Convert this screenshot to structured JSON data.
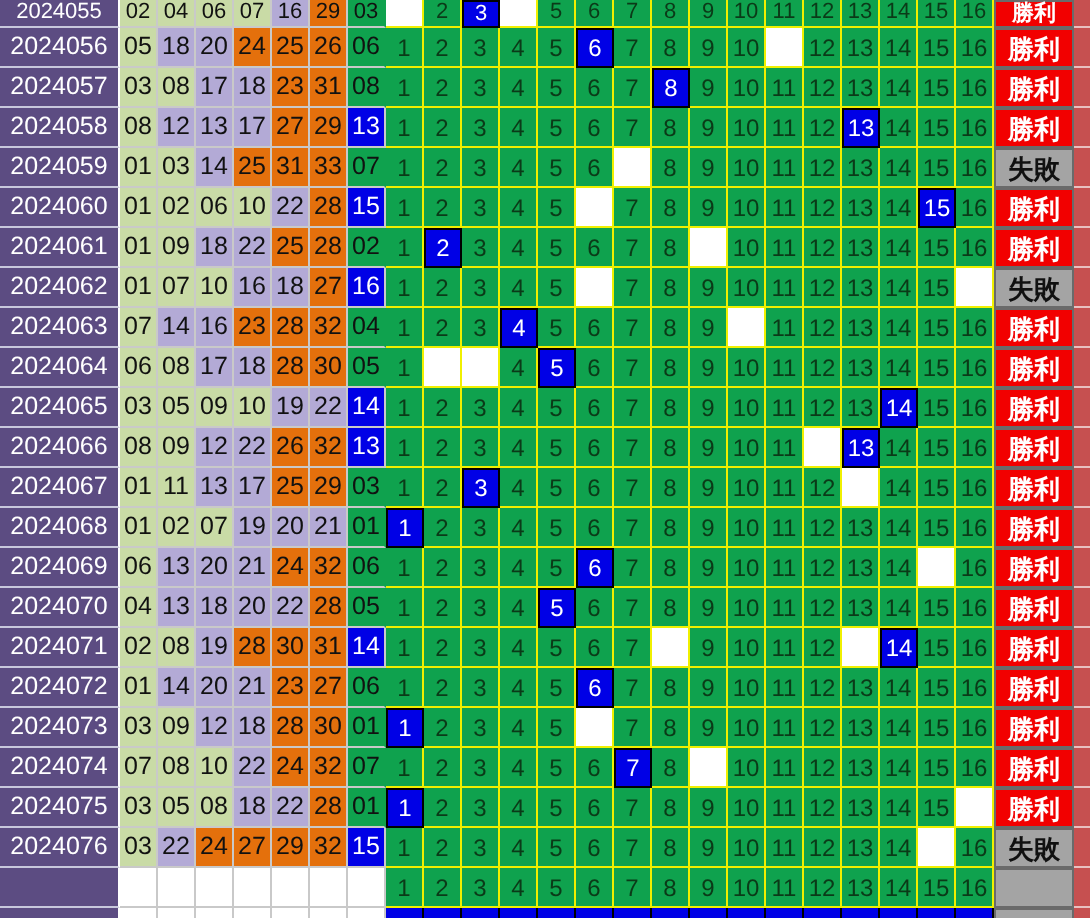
{
  "rows": [
    {
      "period": "2024055",
      "reds": [
        {
          "n": "02",
          "color": "#c9dba6"
        },
        {
          "n": "04",
          "color": "#c9dba6"
        },
        {
          "n": "06",
          "color": "#c9dba6"
        },
        {
          "n": "07",
          "color": "#c9dba6"
        },
        {
          "n": "16",
          "color": "#b3aad6"
        },
        {
          "n": "29",
          "color": "#e4700c"
        }
      ],
      "blue": {
        "n": "03",
        "kind": "plain"
      },
      "cells": [
        {
          "kind": "blank"
        },
        {
          "n": "2",
          "kind": "plain"
        },
        {
          "n": "3",
          "kind": "hit"
        },
        {
          "kind": "blank"
        },
        {
          "n": "5",
          "kind": "plain"
        },
        {
          "n": "6",
          "kind": "plain"
        },
        {
          "n": "7",
          "kind": "plain"
        },
        {
          "n": "8",
          "kind": "plain"
        },
        {
          "n": "9",
          "kind": "plain"
        },
        {
          "n": "10",
          "kind": "plain"
        },
        {
          "n": "11",
          "kind": "plain"
        },
        {
          "n": "12",
          "kind": "plain"
        },
        {
          "n": "13",
          "kind": "plain"
        },
        {
          "n": "14",
          "kind": "plain"
        },
        {
          "n": "15",
          "kind": "plain"
        },
        {
          "n": "16",
          "kind": "plain"
        }
      ],
      "result": {
        "text": "勝利",
        "kind": "win"
      }
    },
    {
      "period": "2024056",
      "reds": [
        {
          "n": "05",
          "color": "#c9dba6"
        },
        {
          "n": "18",
          "color": "#b3aad6"
        },
        {
          "n": "20",
          "color": "#b3aad6"
        },
        {
          "n": "24",
          "color": "#e4700c"
        },
        {
          "n": "25",
          "color": "#e4700c"
        },
        {
          "n": "26",
          "color": "#e4700c"
        }
      ],
      "blue": {
        "n": "06",
        "kind": "plain"
      },
      "cells": [
        {
          "n": "1",
          "kind": "plain"
        },
        {
          "n": "2",
          "kind": "plain"
        },
        {
          "n": "3",
          "kind": "plain"
        },
        {
          "n": "4",
          "kind": "plain"
        },
        {
          "n": "5",
          "kind": "plain"
        },
        {
          "n": "6",
          "kind": "hit"
        },
        {
          "n": "7",
          "kind": "plain"
        },
        {
          "n": "8",
          "kind": "plain"
        },
        {
          "n": "9",
          "kind": "plain"
        },
        {
          "n": "10",
          "kind": "plain"
        },
        {
          "kind": "blank"
        },
        {
          "n": "12",
          "kind": "plain"
        },
        {
          "n": "13",
          "kind": "plain"
        },
        {
          "n": "14",
          "kind": "plain"
        },
        {
          "n": "15",
          "kind": "plain"
        },
        {
          "n": "16",
          "kind": "plain"
        }
      ],
      "result": {
        "text": "勝利",
        "kind": "win"
      }
    },
    {
      "period": "2024057",
      "reds": [
        {
          "n": "03",
          "color": "#c9dba6"
        },
        {
          "n": "08",
          "color": "#c9dba6"
        },
        {
          "n": "17",
          "color": "#b3aad6"
        },
        {
          "n": "18",
          "color": "#b3aad6"
        },
        {
          "n": "23",
          "color": "#e4700c"
        },
        {
          "n": "31",
          "color": "#e4700c"
        }
      ],
      "blue": {
        "n": "08",
        "kind": "plain"
      },
      "cells": [
        {
          "n": "1",
          "kind": "plain"
        },
        {
          "n": "2",
          "kind": "plain"
        },
        {
          "n": "3",
          "kind": "plain"
        },
        {
          "n": "4",
          "kind": "plain"
        },
        {
          "n": "5",
          "kind": "plain"
        },
        {
          "n": "6",
          "kind": "plain"
        },
        {
          "n": "7",
          "kind": "plain"
        },
        {
          "n": "8",
          "kind": "hit"
        },
        {
          "n": "9",
          "kind": "plain"
        },
        {
          "n": "10",
          "kind": "plain"
        },
        {
          "n": "11",
          "kind": "plain"
        },
        {
          "n": "12",
          "kind": "plain"
        },
        {
          "n": "13",
          "kind": "plain"
        },
        {
          "n": "14",
          "kind": "plain"
        },
        {
          "n": "15",
          "kind": "plain"
        },
        {
          "n": "16",
          "kind": "plain"
        }
      ],
      "result": {
        "text": "勝利",
        "kind": "win"
      }
    },
    {
      "period": "2024058",
      "reds": [
        {
          "n": "08",
          "color": "#c9dba6"
        },
        {
          "n": "12",
          "color": "#b3aad6"
        },
        {
          "n": "13",
          "color": "#b3aad6"
        },
        {
          "n": "17",
          "color": "#b3aad6"
        },
        {
          "n": "27",
          "color": "#e4700c"
        },
        {
          "n": "29",
          "color": "#e4700c"
        }
      ],
      "blue": {
        "n": "13",
        "kind": "highlight"
      },
      "cells": [
        {
          "n": "1",
          "kind": "plain"
        },
        {
          "n": "2",
          "kind": "plain"
        },
        {
          "n": "3",
          "kind": "plain"
        },
        {
          "n": "4",
          "kind": "plain"
        },
        {
          "n": "5",
          "kind": "plain"
        },
        {
          "n": "6",
          "kind": "plain"
        },
        {
          "n": "7",
          "kind": "plain"
        },
        {
          "n": "8",
          "kind": "plain"
        },
        {
          "n": "9",
          "kind": "plain"
        },
        {
          "n": "10",
          "kind": "plain"
        },
        {
          "n": "11",
          "kind": "plain"
        },
        {
          "n": "12",
          "kind": "plain"
        },
        {
          "n": "13",
          "kind": "hit"
        },
        {
          "n": "14",
          "kind": "plain"
        },
        {
          "n": "15",
          "kind": "plain"
        },
        {
          "n": "16",
          "kind": "plain"
        }
      ],
      "result": {
        "text": "勝利",
        "kind": "win"
      }
    },
    {
      "period": "2024059",
      "reds": [
        {
          "n": "01",
          "color": "#c9dba6"
        },
        {
          "n": "03",
          "color": "#c9dba6"
        },
        {
          "n": "14",
          "color": "#b3aad6"
        },
        {
          "n": "25",
          "color": "#e4700c"
        },
        {
          "n": "31",
          "color": "#e4700c"
        },
        {
          "n": "33",
          "color": "#e4700c"
        }
      ],
      "blue": {
        "n": "07",
        "kind": "plain"
      },
      "cells": [
        {
          "n": "1",
          "kind": "plain"
        },
        {
          "n": "2",
          "kind": "plain"
        },
        {
          "n": "3",
          "kind": "plain"
        },
        {
          "n": "4",
          "kind": "plain"
        },
        {
          "n": "5",
          "kind": "plain"
        },
        {
          "n": "6",
          "kind": "plain"
        },
        {
          "kind": "blank"
        },
        {
          "n": "8",
          "kind": "plain"
        },
        {
          "n": "9",
          "kind": "plain"
        },
        {
          "n": "10",
          "kind": "plain"
        },
        {
          "n": "11",
          "kind": "plain"
        },
        {
          "n": "12",
          "kind": "plain"
        },
        {
          "n": "13",
          "kind": "plain"
        },
        {
          "n": "14",
          "kind": "plain"
        },
        {
          "n": "15",
          "kind": "plain"
        },
        {
          "n": "16",
          "kind": "plain"
        }
      ],
      "result": {
        "text": "失敗",
        "kind": "loss"
      }
    },
    {
      "period": "2024060",
      "reds": [
        {
          "n": "01",
          "color": "#c9dba6"
        },
        {
          "n": "02",
          "color": "#c9dba6"
        },
        {
          "n": "06",
          "color": "#c9dba6"
        },
        {
          "n": "10",
          "color": "#c9dba6"
        },
        {
          "n": "22",
          "color": "#b3aad6"
        },
        {
          "n": "28",
          "color": "#e4700c"
        }
      ],
      "blue": {
        "n": "15",
        "kind": "highlight"
      },
      "cells": [
        {
          "n": "1",
          "kind": "plain"
        },
        {
          "n": "2",
          "kind": "plain"
        },
        {
          "n": "3",
          "kind": "plain"
        },
        {
          "n": "4",
          "kind": "plain"
        },
        {
          "n": "5",
          "kind": "plain"
        },
        {
          "kind": "blank"
        },
        {
          "n": "7",
          "kind": "plain"
        },
        {
          "n": "8",
          "kind": "plain"
        },
        {
          "n": "9",
          "kind": "plain"
        },
        {
          "n": "10",
          "kind": "plain"
        },
        {
          "n": "11",
          "kind": "plain"
        },
        {
          "n": "12",
          "kind": "plain"
        },
        {
          "n": "13",
          "kind": "plain"
        },
        {
          "n": "14",
          "kind": "plain"
        },
        {
          "n": "15",
          "kind": "hit"
        },
        {
          "n": "16",
          "kind": "plain"
        }
      ],
      "result": {
        "text": "勝利",
        "kind": "win"
      }
    },
    {
      "period": "2024061",
      "reds": [
        {
          "n": "01",
          "color": "#c9dba6"
        },
        {
          "n": "09",
          "color": "#c9dba6"
        },
        {
          "n": "18",
          "color": "#b3aad6"
        },
        {
          "n": "22",
          "color": "#b3aad6"
        },
        {
          "n": "25",
          "color": "#e4700c"
        },
        {
          "n": "28",
          "color": "#e4700c"
        }
      ],
      "blue": {
        "n": "02",
        "kind": "plain"
      },
      "cells": [
        {
          "n": "1",
          "kind": "plain"
        },
        {
          "n": "2",
          "kind": "hit"
        },
        {
          "n": "3",
          "kind": "plain"
        },
        {
          "n": "4",
          "kind": "plain"
        },
        {
          "n": "5",
          "kind": "plain"
        },
        {
          "n": "6",
          "kind": "plain"
        },
        {
          "n": "7",
          "kind": "plain"
        },
        {
          "n": "8",
          "kind": "plain"
        },
        {
          "kind": "blank"
        },
        {
          "n": "10",
          "kind": "plain"
        },
        {
          "n": "11",
          "kind": "plain"
        },
        {
          "n": "12",
          "kind": "plain"
        },
        {
          "n": "13",
          "kind": "plain"
        },
        {
          "n": "14",
          "kind": "plain"
        },
        {
          "n": "15",
          "kind": "plain"
        },
        {
          "n": "16",
          "kind": "plain"
        }
      ],
      "result": {
        "text": "勝利",
        "kind": "win"
      }
    },
    {
      "period": "2024062",
      "reds": [
        {
          "n": "01",
          "color": "#c9dba6"
        },
        {
          "n": "07",
          "color": "#c9dba6"
        },
        {
          "n": "10",
          "color": "#c9dba6"
        },
        {
          "n": "16",
          "color": "#b3aad6"
        },
        {
          "n": "18",
          "color": "#b3aad6"
        },
        {
          "n": "27",
          "color": "#e4700c"
        }
      ],
      "blue": {
        "n": "16",
        "kind": "highlight"
      },
      "cells": [
        {
          "n": "1",
          "kind": "plain"
        },
        {
          "n": "2",
          "kind": "plain"
        },
        {
          "n": "3",
          "kind": "plain"
        },
        {
          "n": "4",
          "kind": "plain"
        },
        {
          "n": "5",
          "kind": "plain"
        },
        {
          "kind": "blank"
        },
        {
          "n": "7",
          "kind": "plain"
        },
        {
          "n": "8",
          "kind": "plain"
        },
        {
          "n": "9",
          "kind": "plain"
        },
        {
          "n": "10",
          "kind": "plain"
        },
        {
          "n": "11",
          "kind": "plain"
        },
        {
          "n": "12",
          "kind": "plain"
        },
        {
          "n": "13",
          "kind": "plain"
        },
        {
          "n": "14",
          "kind": "plain"
        },
        {
          "n": "15",
          "kind": "plain"
        },
        {
          "kind": "blank"
        }
      ],
      "result": {
        "text": "失敗",
        "kind": "loss"
      }
    },
    {
      "period": "2024063",
      "reds": [
        {
          "n": "07",
          "color": "#c9dba6"
        },
        {
          "n": "14",
          "color": "#b3aad6"
        },
        {
          "n": "16",
          "color": "#b3aad6"
        },
        {
          "n": "23",
          "color": "#e4700c"
        },
        {
          "n": "28",
          "color": "#e4700c"
        },
        {
          "n": "32",
          "color": "#e4700c"
        }
      ],
      "blue": {
        "n": "04",
        "kind": "plain"
      },
      "cells": [
        {
          "n": "1",
          "kind": "plain"
        },
        {
          "n": "2",
          "kind": "plain"
        },
        {
          "n": "3",
          "kind": "plain"
        },
        {
          "n": "4",
          "kind": "hit"
        },
        {
          "n": "5",
          "kind": "plain"
        },
        {
          "n": "6",
          "kind": "plain"
        },
        {
          "n": "7",
          "kind": "plain"
        },
        {
          "n": "8",
          "kind": "plain"
        },
        {
          "n": "9",
          "kind": "plain"
        },
        {
          "kind": "blank"
        },
        {
          "n": "11",
          "kind": "plain"
        },
        {
          "n": "12",
          "kind": "plain"
        },
        {
          "n": "13",
          "kind": "plain"
        },
        {
          "n": "14",
          "kind": "plain"
        },
        {
          "n": "15",
          "kind": "plain"
        },
        {
          "n": "16",
          "kind": "plain"
        }
      ],
      "result": {
        "text": "勝利",
        "kind": "win"
      }
    },
    {
      "period": "2024064",
      "reds": [
        {
          "n": "06",
          "color": "#c9dba6"
        },
        {
          "n": "08",
          "color": "#c9dba6"
        },
        {
          "n": "17",
          "color": "#b3aad6"
        },
        {
          "n": "18",
          "color": "#b3aad6"
        },
        {
          "n": "28",
          "color": "#e4700c"
        },
        {
          "n": "30",
          "color": "#e4700c"
        }
      ],
      "blue": {
        "n": "05",
        "kind": "plain"
      },
      "cells": [
        {
          "n": "1",
          "kind": "plain"
        },
        {
          "kind": "blank"
        },
        {
          "kind": "blank"
        },
        {
          "n": "4",
          "kind": "plain"
        },
        {
          "n": "5",
          "kind": "hit"
        },
        {
          "n": "6",
          "kind": "plain"
        },
        {
          "n": "7",
          "kind": "plain"
        },
        {
          "n": "8",
          "kind": "plain"
        },
        {
          "n": "9",
          "kind": "plain"
        },
        {
          "n": "10",
          "kind": "plain"
        },
        {
          "n": "11",
          "kind": "plain"
        },
        {
          "n": "12",
          "kind": "plain"
        },
        {
          "n": "13",
          "kind": "plain"
        },
        {
          "n": "14",
          "kind": "plain"
        },
        {
          "n": "15",
          "kind": "plain"
        },
        {
          "n": "16",
          "kind": "plain"
        }
      ],
      "result": {
        "text": "勝利",
        "kind": "win"
      }
    },
    {
      "period": "2024065",
      "reds": [
        {
          "n": "03",
          "color": "#c9dba6"
        },
        {
          "n": "05",
          "color": "#c9dba6"
        },
        {
          "n": "09",
          "color": "#c9dba6"
        },
        {
          "n": "10",
          "color": "#c9dba6"
        },
        {
          "n": "19",
          "color": "#b3aad6"
        },
        {
          "n": "22",
          "color": "#b3aad6"
        }
      ],
      "blue": {
        "n": "14",
        "kind": "highlight"
      },
      "cells": [
        {
          "n": "1",
          "kind": "plain"
        },
        {
          "n": "2",
          "kind": "plain"
        },
        {
          "n": "3",
          "kind": "plain"
        },
        {
          "n": "4",
          "kind": "plain"
        },
        {
          "n": "5",
          "kind": "plain"
        },
        {
          "n": "6",
          "kind": "plain"
        },
        {
          "n": "7",
          "kind": "plain"
        },
        {
          "n": "8",
          "kind": "plain"
        },
        {
          "n": "9",
          "kind": "plain"
        },
        {
          "n": "10",
          "kind": "plain"
        },
        {
          "n": "11",
          "kind": "plain"
        },
        {
          "n": "12",
          "kind": "plain"
        },
        {
          "n": "13",
          "kind": "plain"
        },
        {
          "n": "14",
          "kind": "hit"
        },
        {
          "n": "15",
          "kind": "plain"
        },
        {
          "n": "16",
          "kind": "plain"
        }
      ],
      "result": {
        "text": "勝利",
        "kind": "win"
      }
    },
    {
      "period": "2024066",
      "reds": [
        {
          "n": "08",
          "color": "#c9dba6"
        },
        {
          "n": "09",
          "color": "#c9dba6"
        },
        {
          "n": "12",
          "color": "#b3aad6"
        },
        {
          "n": "22",
          "color": "#b3aad6"
        },
        {
          "n": "26",
          "color": "#e4700c"
        },
        {
          "n": "32",
          "color": "#e4700c"
        }
      ],
      "blue": {
        "n": "13",
        "kind": "highlight"
      },
      "cells": [
        {
          "n": "1",
          "kind": "plain"
        },
        {
          "n": "2",
          "kind": "plain"
        },
        {
          "n": "3",
          "kind": "plain"
        },
        {
          "n": "4",
          "kind": "plain"
        },
        {
          "n": "5",
          "kind": "plain"
        },
        {
          "n": "6",
          "kind": "plain"
        },
        {
          "n": "7",
          "kind": "plain"
        },
        {
          "n": "8",
          "kind": "plain"
        },
        {
          "n": "9",
          "kind": "plain"
        },
        {
          "n": "10",
          "kind": "plain"
        },
        {
          "n": "11",
          "kind": "plain"
        },
        {
          "kind": "blank"
        },
        {
          "n": "13",
          "kind": "hit"
        },
        {
          "n": "14",
          "kind": "plain"
        },
        {
          "n": "15",
          "kind": "plain"
        },
        {
          "n": "16",
          "kind": "plain"
        }
      ],
      "result": {
        "text": "勝利",
        "kind": "win"
      }
    },
    {
      "period": "2024067",
      "reds": [
        {
          "n": "01",
          "color": "#c9dba6"
        },
        {
          "n": "11",
          "color": "#c9dba6"
        },
        {
          "n": "13",
          "color": "#b3aad6"
        },
        {
          "n": "17",
          "color": "#b3aad6"
        },
        {
          "n": "25",
          "color": "#e4700c"
        },
        {
          "n": "29",
          "color": "#e4700c"
        }
      ],
      "blue": {
        "n": "03",
        "kind": "plain"
      },
      "cells": [
        {
          "n": "1",
          "kind": "plain"
        },
        {
          "n": "2",
          "kind": "plain"
        },
        {
          "n": "3",
          "kind": "hit"
        },
        {
          "n": "4",
          "kind": "plain"
        },
        {
          "n": "5",
          "kind": "plain"
        },
        {
          "n": "6",
          "kind": "plain"
        },
        {
          "n": "7",
          "kind": "plain"
        },
        {
          "n": "8",
          "kind": "plain"
        },
        {
          "n": "9",
          "kind": "plain"
        },
        {
          "n": "10",
          "kind": "plain"
        },
        {
          "n": "11",
          "kind": "plain"
        },
        {
          "n": "12",
          "kind": "plain"
        },
        {
          "kind": "blank"
        },
        {
          "n": "14",
          "kind": "plain"
        },
        {
          "n": "15",
          "kind": "plain"
        },
        {
          "n": "16",
          "kind": "plain"
        }
      ],
      "result": {
        "text": "勝利",
        "kind": "win"
      }
    },
    {
      "period": "2024068",
      "reds": [
        {
          "n": "01",
          "color": "#c9dba6"
        },
        {
          "n": "02",
          "color": "#c9dba6"
        },
        {
          "n": "07",
          "color": "#c9dba6"
        },
        {
          "n": "19",
          "color": "#b3aad6"
        },
        {
          "n": "20",
          "color": "#b3aad6"
        },
        {
          "n": "21",
          "color": "#b3aad6"
        }
      ],
      "blue": {
        "n": "01",
        "kind": "plain"
      },
      "cells": [
        {
          "n": "1",
          "kind": "hit"
        },
        {
          "n": "2",
          "kind": "plain"
        },
        {
          "n": "3",
          "kind": "plain"
        },
        {
          "n": "4",
          "kind": "plain"
        },
        {
          "n": "5",
          "kind": "plain"
        },
        {
          "n": "6",
          "kind": "plain"
        },
        {
          "n": "7",
          "kind": "plain"
        },
        {
          "n": "8",
          "kind": "plain"
        },
        {
          "n": "9",
          "kind": "plain"
        },
        {
          "n": "10",
          "kind": "plain"
        },
        {
          "n": "11",
          "kind": "plain"
        },
        {
          "n": "12",
          "kind": "plain"
        },
        {
          "n": "13",
          "kind": "plain"
        },
        {
          "n": "14",
          "kind": "plain"
        },
        {
          "n": "15",
          "kind": "plain"
        },
        {
          "n": "16",
          "kind": "plain"
        }
      ],
      "result": {
        "text": "勝利",
        "kind": "win"
      }
    },
    {
      "period": "2024069",
      "reds": [
        {
          "n": "06",
          "color": "#c9dba6"
        },
        {
          "n": "13",
          "color": "#b3aad6"
        },
        {
          "n": "20",
          "color": "#b3aad6"
        },
        {
          "n": "21",
          "color": "#b3aad6"
        },
        {
          "n": "24",
          "color": "#e4700c"
        },
        {
          "n": "32",
          "color": "#e4700c"
        }
      ],
      "blue": {
        "n": "06",
        "kind": "plain"
      },
      "cells": [
        {
          "n": "1",
          "kind": "plain"
        },
        {
          "n": "2",
          "kind": "plain"
        },
        {
          "n": "3",
          "kind": "plain"
        },
        {
          "n": "4",
          "kind": "plain"
        },
        {
          "n": "5",
          "kind": "plain"
        },
        {
          "n": "6",
          "kind": "hit"
        },
        {
          "n": "7",
          "kind": "plain"
        },
        {
          "n": "8",
          "kind": "plain"
        },
        {
          "n": "9",
          "kind": "plain"
        },
        {
          "n": "10",
          "kind": "plain"
        },
        {
          "n": "11",
          "kind": "plain"
        },
        {
          "n": "12",
          "kind": "plain"
        },
        {
          "n": "13",
          "kind": "plain"
        },
        {
          "n": "14",
          "kind": "plain"
        },
        {
          "kind": "blank"
        },
        {
          "n": "16",
          "kind": "plain"
        }
      ],
      "result": {
        "text": "勝利",
        "kind": "win"
      }
    },
    {
      "period": "2024070",
      "reds": [
        {
          "n": "04",
          "color": "#c9dba6"
        },
        {
          "n": "13",
          "color": "#b3aad6"
        },
        {
          "n": "18",
          "color": "#b3aad6"
        },
        {
          "n": "20",
          "color": "#b3aad6"
        },
        {
          "n": "22",
          "color": "#b3aad6"
        },
        {
          "n": "28",
          "color": "#e4700c"
        }
      ],
      "blue": {
        "n": "05",
        "kind": "plain"
      },
      "cells": [
        {
          "n": "1",
          "kind": "plain"
        },
        {
          "n": "2",
          "kind": "plain"
        },
        {
          "n": "3",
          "kind": "plain"
        },
        {
          "n": "4",
          "kind": "plain"
        },
        {
          "n": "5",
          "kind": "hit"
        },
        {
          "n": "6",
          "kind": "plain"
        },
        {
          "n": "7",
          "kind": "plain"
        },
        {
          "n": "8",
          "kind": "plain"
        },
        {
          "n": "9",
          "kind": "plain"
        },
        {
          "n": "10",
          "kind": "plain"
        },
        {
          "n": "11",
          "kind": "plain"
        },
        {
          "n": "12",
          "kind": "plain"
        },
        {
          "n": "13",
          "kind": "plain"
        },
        {
          "n": "14",
          "kind": "plain"
        },
        {
          "n": "15",
          "kind": "plain"
        },
        {
          "n": "16",
          "kind": "plain"
        }
      ],
      "result": {
        "text": "勝利",
        "kind": "win"
      }
    },
    {
      "period": "2024071",
      "reds": [
        {
          "n": "02",
          "color": "#c9dba6"
        },
        {
          "n": "08",
          "color": "#c9dba6"
        },
        {
          "n": "19",
          "color": "#b3aad6"
        },
        {
          "n": "28",
          "color": "#e4700c"
        },
        {
          "n": "30",
          "color": "#e4700c"
        },
        {
          "n": "31",
          "color": "#e4700c"
        }
      ],
      "blue": {
        "n": "14",
        "kind": "highlight"
      },
      "cells": [
        {
          "n": "1",
          "kind": "plain"
        },
        {
          "n": "2",
          "kind": "plain"
        },
        {
          "n": "3",
          "kind": "plain"
        },
        {
          "n": "4",
          "kind": "plain"
        },
        {
          "n": "5",
          "kind": "plain"
        },
        {
          "n": "6",
          "kind": "plain"
        },
        {
          "n": "7",
          "kind": "plain"
        },
        {
          "kind": "blank"
        },
        {
          "n": "9",
          "kind": "plain"
        },
        {
          "n": "10",
          "kind": "plain"
        },
        {
          "n": "11",
          "kind": "plain"
        },
        {
          "n": "12",
          "kind": "plain"
        },
        {
          "kind": "blank"
        },
        {
          "n": "14",
          "kind": "hit"
        },
        {
          "n": "15",
          "kind": "plain"
        },
        {
          "n": "16",
          "kind": "plain"
        }
      ],
      "result": {
        "text": "勝利",
        "kind": "win"
      }
    },
    {
      "period": "2024072",
      "reds": [
        {
          "n": "01",
          "color": "#c9dba6"
        },
        {
          "n": "14",
          "color": "#b3aad6"
        },
        {
          "n": "20",
          "color": "#b3aad6"
        },
        {
          "n": "21",
          "color": "#b3aad6"
        },
        {
          "n": "23",
          "color": "#e4700c"
        },
        {
          "n": "27",
          "color": "#e4700c"
        }
      ],
      "blue": {
        "n": "06",
        "kind": "plain"
      },
      "cells": [
        {
          "n": "1",
          "kind": "plain"
        },
        {
          "n": "2",
          "kind": "plain"
        },
        {
          "n": "3",
          "kind": "plain"
        },
        {
          "n": "4",
          "kind": "plain"
        },
        {
          "n": "5",
          "kind": "plain"
        },
        {
          "n": "6",
          "kind": "hit"
        },
        {
          "n": "7",
          "kind": "plain"
        },
        {
          "n": "8",
          "kind": "plain"
        },
        {
          "n": "9",
          "kind": "plain"
        },
        {
          "n": "10",
          "kind": "plain"
        },
        {
          "n": "11",
          "kind": "plain"
        },
        {
          "n": "12",
          "kind": "plain"
        },
        {
          "n": "13",
          "kind": "plain"
        },
        {
          "n": "14",
          "kind": "plain"
        },
        {
          "n": "15",
          "kind": "plain"
        },
        {
          "n": "16",
          "kind": "plain"
        }
      ],
      "result": {
        "text": "勝利",
        "kind": "win"
      }
    },
    {
      "period": "2024073",
      "reds": [
        {
          "n": "03",
          "color": "#c9dba6"
        },
        {
          "n": "09",
          "color": "#c9dba6"
        },
        {
          "n": "12",
          "color": "#b3aad6"
        },
        {
          "n": "18",
          "color": "#b3aad6"
        },
        {
          "n": "28",
          "color": "#e4700c"
        },
        {
          "n": "30",
          "color": "#e4700c"
        }
      ],
      "blue": {
        "n": "01",
        "kind": "plain"
      },
      "cells": [
        {
          "n": "1",
          "kind": "hit"
        },
        {
          "n": "2",
          "kind": "plain"
        },
        {
          "n": "3",
          "kind": "plain"
        },
        {
          "n": "4",
          "kind": "plain"
        },
        {
          "n": "5",
          "kind": "plain"
        },
        {
          "kind": "blank"
        },
        {
          "n": "7",
          "kind": "plain"
        },
        {
          "n": "8",
          "kind": "plain"
        },
        {
          "n": "9",
          "kind": "plain"
        },
        {
          "n": "10",
          "kind": "plain"
        },
        {
          "n": "11",
          "kind": "plain"
        },
        {
          "n": "12",
          "kind": "plain"
        },
        {
          "n": "13",
          "kind": "plain"
        },
        {
          "n": "14",
          "kind": "plain"
        },
        {
          "n": "15",
          "kind": "plain"
        },
        {
          "n": "16",
          "kind": "plain"
        }
      ],
      "result": {
        "text": "勝利",
        "kind": "win"
      }
    },
    {
      "period": "2024074",
      "reds": [
        {
          "n": "07",
          "color": "#c9dba6"
        },
        {
          "n": "08",
          "color": "#c9dba6"
        },
        {
          "n": "10",
          "color": "#c9dba6"
        },
        {
          "n": "22",
          "color": "#b3aad6"
        },
        {
          "n": "24",
          "color": "#e4700c"
        },
        {
          "n": "32",
          "color": "#e4700c"
        }
      ],
      "blue": {
        "n": "07",
        "kind": "plain"
      },
      "cells": [
        {
          "n": "1",
          "kind": "plain"
        },
        {
          "n": "2",
          "kind": "plain"
        },
        {
          "n": "3",
          "kind": "plain"
        },
        {
          "n": "4",
          "kind": "plain"
        },
        {
          "n": "5",
          "kind": "plain"
        },
        {
          "n": "6",
          "kind": "plain"
        },
        {
          "n": "7",
          "kind": "hit"
        },
        {
          "n": "8",
          "kind": "plain"
        },
        {
          "kind": "blank"
        },
        {
          "n": "10",
          "kind": "plain"
        },
        {
          "n": "11",
          "kind": "plain"
        },
        {
          "n": "12",
          "kind": "plain"
        },
        {
          "n": "13",
          "kind": "plain"
        },
        {
          "n": "14",
          "kind": "plain"
        },
        {
          "n": "15",
          "kind": "plain"
        },
        {
          "n": "16",
          "kind": "plain"
        }
      ],
      "result": {
        "text": "勝利",
        "kind": "win"
      }
    },
    {
      "period": "2024075",
      "reds": [
        {
          "n": "03",
          "color": "#c9dba6"
        },
        {
          "n": "05",
          "color": "#c9dba6"
        },
        {
          "n": "08",
          "color": "#c9dba6"
        },
        {
          "n": "18",
          "color": "#b3aad6"
        },
        {
          "n": "22",
          "color": "#b3aad6"
        },
        {
          "n": "28",
          "color": "#e4700c"
        }
      ],
      "blue": {
        "n": "01",
        "kind": "plain"
      },
      "cells": [
        {
          "n": "1",
          "kind": "hit"
        },
        {
          "n": "2",
          "kind": "plain"
        },
        {
          "n": "3",
          "kind": "plain"
        },
        {
          "n": "4",
          "kind": "plain"
        },
        {
          "n": "5",
          "kind": "plain"
        },
        {
          "n": "6",
          "kind": "plain"
        },
        {
          "n": "7",
          "kind": "plain"
        },
        {
          "n": "8",
          "kind": "plain"
        },
        {
          "n": "9",
          "kind": "plain"
        },
        {
          "n": "10",
          "kind": "plain"
        },
        {
          "n": "11",
          "kind": "plain"
        },
        {
          "n": "12",
          "kind": "plain"
        },
        {
          "n": "13",
          "kind": "plain"
        },
        {
          "n": "14",
          "kind": "plain"
        },
        {
          "n": "15",
          "kind": "plain"
        },
        {
          "kind": "blank"
        }
      ],
      "result": {
        "text": "勝利",
        "kind": "win"
      }
    },
    {
      "period": "2024076",
      "reds": [
        {
          "n": "03",
          "color": "#c9dba6"
        },
        {
          "n": "22",
          "color": "#b3aad6"
        },
        {
          "n": "24",
          "color": "#e4700c"
        },
        {
          "n": "27",
          "color": "#e4700c"
        },
        {
          "n": "29",
          "color": "#e4700c"
        },
        {
          "n": "32",
          "color": "#e4700c"
        }
      ],
      "blue": {
        "n": "15",
        "kind": "highlight"
      },
      "cells": [
        {
          "n": "1",
          "kind": "plain"
        },
        {
          "n": "2",
          "kind": "plain"
        },
        {
          "n": "3",
          "kind": "plain"
        },
        {
          "n": "4",
          "kind": "plain"
        },
        {
          "n": "5",
          "kind": "plain"
        },
        {
          "n": "6",
          "kind": "plain"
        },
        {
          "n": "7",
          "kind": "plain"
        },
        {
          "n": "8",
          "kind": "plain"
        },
        {
          "n": "9",
          "kind": "plain"
        },
        {
          "n": "10",
          "kind": "plain"
        },
        {
          "n": "11",
          "kind": "plain"
        },
        {
          "n": "12",
          "kind": "plain"
        },
        {
          "n": "13",
          "kind": "plain"
        },
        {
          "n": "14",
          "kind": "plain"
        },
        {
          "kind": "blank"
        },
        {
          "n": "16",
          "kind": "plain"
        }
      ],
      "result": {
        "text": "失敗",
        "kind": "loss"
      }
    }
  ],
  "forecast_row": {
    "cells": [
      {
        "n": "1",
        "kind": "plain"
      },
      {
        "n": "2",
        "kind": "plain"
      },
      {
        "n": "3",
        "kind": "plain"
      },
      {
        "n": "4",
        "kind": "plain"
      },
      {
        "n": "5",
        "kind": "plain"
      },
      {
        "n": "6",
        "kind": "plain"
      },
      {
        "n": "7",
        "kind": "plain"
      },
      {
        "n": "8",
        "kind": "plain"
      },
      {
        "n": "9",
        "kind": "plain"
      },
      {
        "n": "10",
        "kind": "plain"
      },
      {
        "n": "11",
        "kind": "plain"
      },
      {
        "n": "12",
        "kind": "plain"
      },
      {
        "n": "13",
        "kind": "plain"
      },
      {
        "n": "14",
        "kind": "plain"
      },
      {
        "n": "15",
        "kind": "plain"
      },
      {
        "n": "16",
        "kind": "plain"
      }
    ]
  }
}
